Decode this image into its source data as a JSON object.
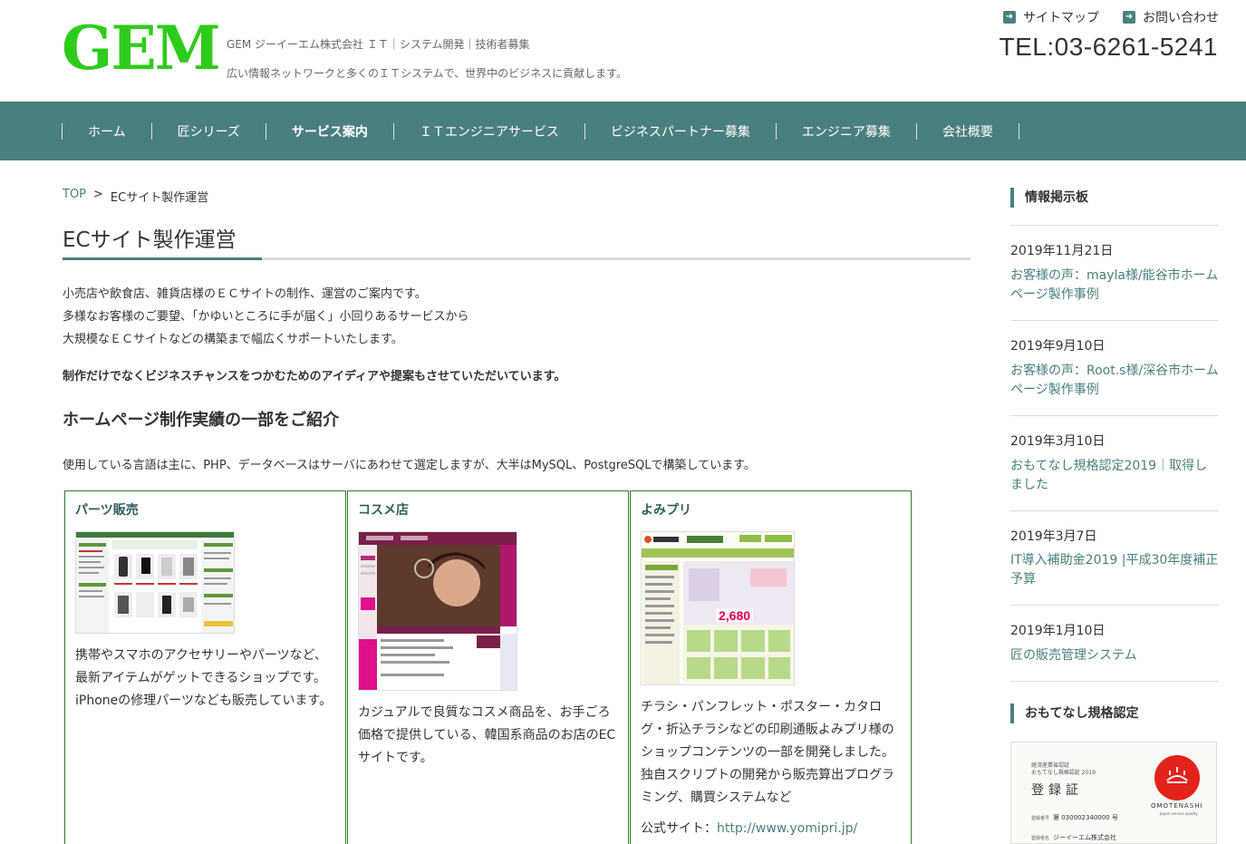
{
  "header": {
    "logo": "GEM",
    "tagline1": "GEM ジーイーエム株式会社 ＩＴ｜システム開発｜技術者募集",
    "tagline2": "広い情報ネットワークと多くのＩＴシステムで、世界中のビジネスに貢献します。",
    "links": [
      {
        "label": "サイトマップ",
        "icon": "arrow-right-icon"
      },
      {
        "label": "お問い合わせ",
        "icon": "arrow-right-icon"
      }
    ],
    "tel": "TEL:03-6261-5241"
  },
  "nav": {
    "items": [
      {
        "label": "ホーム",
        "active": false
      },
      {
        "label": "匠シリーズ",
        "active": false
      },
      {
        "label": "サービス案内",
        "active": true
      },
      {
        "label": "ＩＴエンジニアサービス",
        "active": false
      },
      {
        "label": "ビジネスパートナー募集",
        "active": false
      },
      {
        "label": "エンジニア募集",
        "active": false
      },
      {
        "label": "会社概要",
        "active": false
      }
    ]
  },
  "breadcrumb": {
    "home": "TOP",
    "sep": ">",
    "current": "ECサイト製作運営"
  },
  "main": {
    "title": "ECサイト製作運営",
    "intro": [
      "小売店や飲食店、雑貨店様のＥＣサイトの制作、運営のご案内です。",
      "多様なお客様のご要望、「かゆいところに手が届く」小回りあるサービスから",
      "大規模なＥＣサイトなどの構築まで幅広くサポートいたします。"
    ],
    "bold_line": "制作だけでなくビジネスチャンスをつかむためのアイディアや提案もさせていただいています。",
    "section_title": "ホームページ制作実績の一部をご紹介",
    "lang_note": "使用している言語は主に、PHP、データベースはサーバにあわせて選定しますが、大半はMySQL、PostgreSQLで構築しています。",
    "cards": [
      {
        "title": "パーツ販売",
        "desc": "携帯やスマホのアクセサリーやパーツなど、最新アイテムがゲットできるショップです。iPhoneの修理パーツなども販売しています。"
      },
      {
        "title": "コスメ店",
        "desc": "カジュアルで良質なコスメ商品を、お手ごろ価格で提供している、韓国系商品のお店のECサイトです。"
      },
      {
        "title": "よみプリ",
        "desc": "チラシ・パンフレット・ポスター・カタログ・折込チラシなどの印刷通販よみプリ様のショップコンテンツの一部を開発しました。独自スクリプトの開発から販売算出プログラミング、購買システムなど",
        "link_prefix": "公式サイト：",
        "link": "http://www.yomipri.jp/",
        "price": "2,680"
      }
    ]
  },
  "sidebar": {
    "news_head": "情報掲示板",
    "news": [
      {
        "date": "2019年11月21日",
        "title": "お客様の声：mayla様/能谷市ホームページ製作事例"
      },
      {
        "date": "2019年9月10日",
        "title": "お客様の声：Root.s様/深谷市ホームページ製作事例"
      },
      {
        "date": "2019年3月10日",
        "title": "おもてなし規格認定2019｜取得しました"
      },
      {
        "date": "2019年3月7日",
        "title": "IT導入補助金2019 |平成30年度補正予算"
      },
      {
        "date": "2019年1月10日",
        "title": "匠の販売管理システム"
      }
    ],
    "cert_head": "おもてなし規格認定",
    "cert": {
      "line1": "経済産業省認証",
      "line2": "おもてなし規格認証 2019",
      "title": "登録証",
      "brand": "OMOTENASHI",
      "brand_sub": "Japan service quality",
      "reg_label": "登録番号",
      "reg_no": "第 030002340000 号",
      "company_label": "登録者名",
      "company": "ジーイーエム株式会社"
    }
  },
  "colors": {
    "brand_green": "#2ecc1a",
    "nav_teal": "#4a7f80",
    "card_border": "#2f7a2f"
  }
}
